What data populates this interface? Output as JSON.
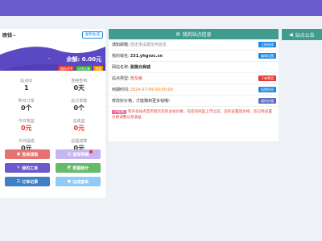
{
  "left": {
    "title": "晚钱~",
    "copy_button": "复制生成",
    "dash": "-",
    "balance": "余额: 0.00元",
    "badges": [
      {
        "label": "我的APP",
        "color": "#e53935"
      },
      {
        "label": "分销文章",
        "color": "#43a047"
      },
      {
        "label": "充值",
        "color": "#fb8c00"
      }
    ],
    "stats": [
      {
        "label": "站点ID",
        "value": "1",
        "red": false
      },
      {
        "label": "连续签到",
        "value": "0天",
        "red": false
      },
      {
        "label": "昨日订单",
        "value": "0个",
        "red": false
      },
      {
        "label": "总订单数",
        "value": "0个",
        "red": false
      },
      {
        "label": "今日收益",
        "value": "0元",
        "red": true
      },
      {
        "label": "总收益",
        "value": "0元",
        "red": true
      },
      {
        "label": "今日提成",
        "value": "0元",
        "red": false
      },
      {
        "label": "总提成数",
        "value": "0元",
        "red": false
      }
    ],
    "buttons": [
      {
        "label": "签到领取",
        "icon": "▣",
        "color": "#e57373"
      },
      {
        "label": "提现明细",
        "icon": "▤",
        "color": "#c5b6f0"
      },
      {
        "label": "我的工单",
        "icon": "✎",
        "color": "#6a5acd"
      },
      {
        "label": "数据统计",
        "icon": "◩",
        "color": "#66bb6a"
      },
      {
        "label": "订单记录",
        "icon": "☰",
        "color": "#3f7fc4"
      },
      {
        "label": "在线查单",
        "icon": "●",
        "color": "#90caf9"
      }
    ]
  },
  "mid": {
    "header": "我的站点信息",
    "rows": [
      {
        "k": "通知邮箱:",
        "v": "您还未设置任何信息",
        "vclass": "gray",
        "btn": "立即修改",
        "btncolor": "#1e88e5"
      },
      {
        "k": "我的域名:",
        "v": "231.yhgvzc.cn",
        "vclass": "bold",
        "btn": "编辑设置",
        "btncolor": "#1e88e5"
      },
      {
        "k": "网站名称:",
        "v": "蓝微云商城",
        "vclass": "bold",
        "btn": "",
        "btncolor": ""
      },
      {
        "k": "站点类型:",
        "v": "普及版",
        "vclass": "red",
        "btn": "下单费用",
        "btncolor": "#e53935"
      },
      {
        "k": "到期时间:",
        "v": "2024-07-09 00:00:00",
        "vclass": "orange",
        "btn": "续费时间",
        "btncolor": "#1e88e5"
      },
      {
        "k": "修改好价格，才能赚到更多钱哦!",
        "v": "",
        "vclass": "",
        "btn": "操作价格",
        "btncolor": "#5c6bc0"
      }
    ],
    "notice_tag": "小提醒",
    "notice": "有许多站点首页提示您的主站价格，在您的商品上市之前，您的设置后价格，您已经设置价格调整以及收益"
  },
  "right": {
    "header": "站点公告"
  },
  "colors": {
    "topbar": "#6a5acd",
    "panel_header": "#3f9c8e",
    "card_bg": "#5b49c4"
  }
}
